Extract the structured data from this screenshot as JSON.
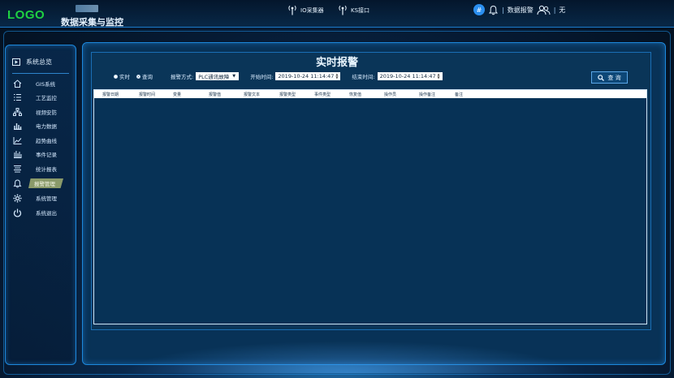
{
  "header": {
    "logo": "LOGO",
    "system_title": "数据采集与监控",
    "nav": [
      {
        "label": "IO采集器",
        "icon": "antenna-icon"
      },
      {
        "label": "KS接口",
        "icon": "antenna-icon"
      }
    ],
    "hash_label": "#",
    "alarm_label": "数据报警",
    "user_label": "无"
  },
  "sidebar": {
    "title": "系统总览",
    "items": [
      {
        "label": "GIS系统",
        "icon": "home-icon"
      },
      {
        "label": "工艺监控",
        "icon": "list-icon"
      },
      {
        "label": "视频安防",
        "icon": "network-icon"
      },
      {
        "label": "电力数据",
        "icon": "bar-chart-icon"
      },
      {
        "label": "趋势曲线",
        "icon": "line-chart-icon"
      },
      {
        "label": "事件记录",
        "icon": "bars-icon"
      },
      {
        "label": "统计报表",
        "icon": "report-icon"
      },
      {
        "label": "报警管理",
        "icon": "bell-icon",
        "active": true
      },
      {
        "label": "系统管理",
        "icon": "gear-icon"
      },
      {
        "label": "系统退出",
        "icon": "power-icon"
      }
    ]
  },
  "main": {
    "title": "实时报警",
    "filters": {
      "radio_realtime": "实时",
      "radio_query": "查询",
      "alarm_mode_label": "报警方式:",
      "alarm_mode_value": "PLC通讯故障",
      "start_label": "开始时间:",
      "start_value": "2019-10-24 11:14:47",
      "end_label": "结束时间:",
      "end_value": "2019-10-24 11:14:47"
    },
    "query_button": "查 询",
    "table_columns": [
      "报警日期",
      "报警时间",
      "变量",
      "报警值",
      "报警文本",
      "报警类型",
      "事件类型",
      "恢复值",
      "操作员",
      "操作备注",
      "备注"
    ],
    "table_rows": []
  }
}
